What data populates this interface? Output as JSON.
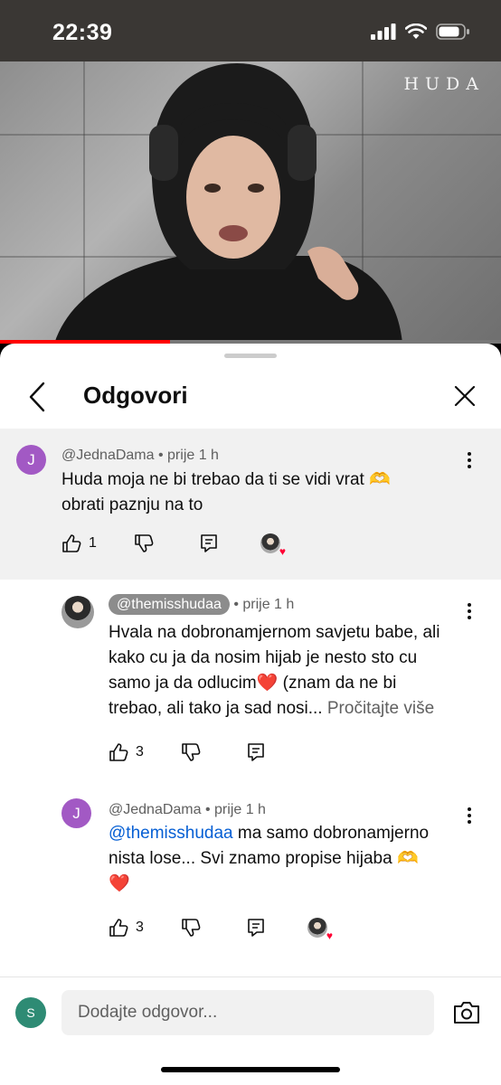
{
  "status_bar": {
    "time": "22:39"
  },
  "video": {
    "watermark": "HUDA",
    "progress": 0.34
  },
  "sheet": {
    "title": "Odgovori"
  },
  "comments": [
    {
      "author": "@JednaDama",
      "age": "prije 1 h",
      "avatar_letter": "J",
      "text_line1": "Huda moja ne bi trebao da ti se vidi vrat 🫶",
      "text_line2": "obrati paznju na to",
      "likes": "1"
    },
    {
      "author": "@themisshudaa",
      "age": "prije 1 h",
      "text_line1": "Hvala na dobronamjernom savjetu babe, ali",
      "text_line2": "kako cu ja da nosim hijab je nesto sto cu",
      "text_line3": "samo ja da odlucim❤️  (znam da ne bi",
      "text_line4": "trebao, ali tako ja sad nosi...",
      "read_more": "Pročitajte više",
      "likes": "3"
    },
    {
      "author": "@JednaDama",
      "age": "prije 1 h",
      "avatar_letter": "J",
      "mention": "@themisshudaa",
      "text_line1_rest": " ma samo dobronamjerno",
      "text_line2": "nista lose... Svi znamo propise hijaba 🫶",
      "text_line3": "❤️",
      "likes": "3"
    }
  ],
  "meta_separator": "•",
  "reply_box": {
    "avatar_letter": "S",
    "placeholder": "Dodajte odgovor..."
  },
  "colors": {
    "accent": "#ff0000",
    "avatar_j": "#a259c4",
    "avatar_me": "#2e8b74",
    "link": "#065fd4"
  }
}
